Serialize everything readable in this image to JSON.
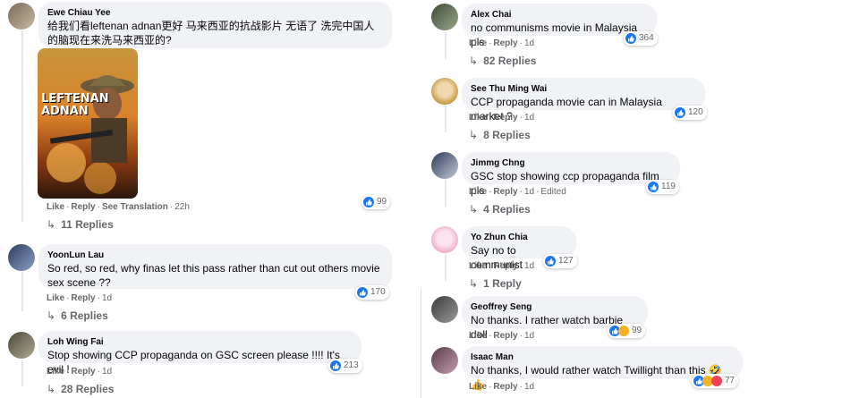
{
  "labels": {
    "like": "Like",
    "reply": "Reply",
    "see_translation": "See Translation",
    "edited": "Edited"
  },
  "colors": {
    "bubble": "#f0f2f5",
    "meta": "#65676b",
    "like_blue": "#1877f2"
  },
  "poster": {
    "title_line1": "LEFTENAN",
    "title_line2": "ADNAN"
  },
  "comments": [
    {
      "author": "Ewe Chiau Yee",
      "text": "给我们看leftenan adnan更好 马来西亚的抗战影片 无语了 洗完中国人的脑现在来洗马来西亚的?",
      "time": "22h",
      "reactions": "99",
      "replies": "11 Replies"
    },
    {
      "author": "YoonLun Lau",
      "text": "So red, so red, why finas let this pass rather than cut out others movie sex scene ??",
      "time": "1d",
      "reactions": "170",
      "replies": "6 Replies"
    },
    {
      "author": "Loh Wing Fai",
      "text": "Stop showing CCP propaganda on GSC screen please !!!! It's evil !",
      "time": "1d",
      "reactions": "213",
      "replies": "28 Replies"
    },
    {
      "author": "Alex Chai",
      "text": "no communisms movie in Malaysia pls",
      "time": "1d",
      "reactions": "364",
      "replies": "82 Replies"
    },
    {
      "author": "See Thu Ming Wai",
      "text": "CCP propaganda movie can in Malaysia market ?",
      "time": "1d",
      "reactions": "120",
      "replies": "8 Replies"
    },
    {
      "author": "Jimmg Chng",
      "text": "GSC stop showing ccp propaganda film pls",
      "time": "1d",
      "reactions": "119",
      "replies": "4 Replies"
    },
    {
      "author": "Yo Zhun Chia",
      "text": "Say no to communist",
      "time": "1d",
      "reactions": "127",
      "replies": "1 Reply"
    },
    {
      "author": "Geoffrey Seng",
      "text": "No thanks. I rather watch barbie doll",
      "time": "1d",
      "reactions": "99"
    },
    {
      "author": "Isaac Man",
      "text": "No thanks, I would rather watch Twillight than this 🤣👍",
      "time": "1d",
      "reactions": "77"
    }
  ]
}
